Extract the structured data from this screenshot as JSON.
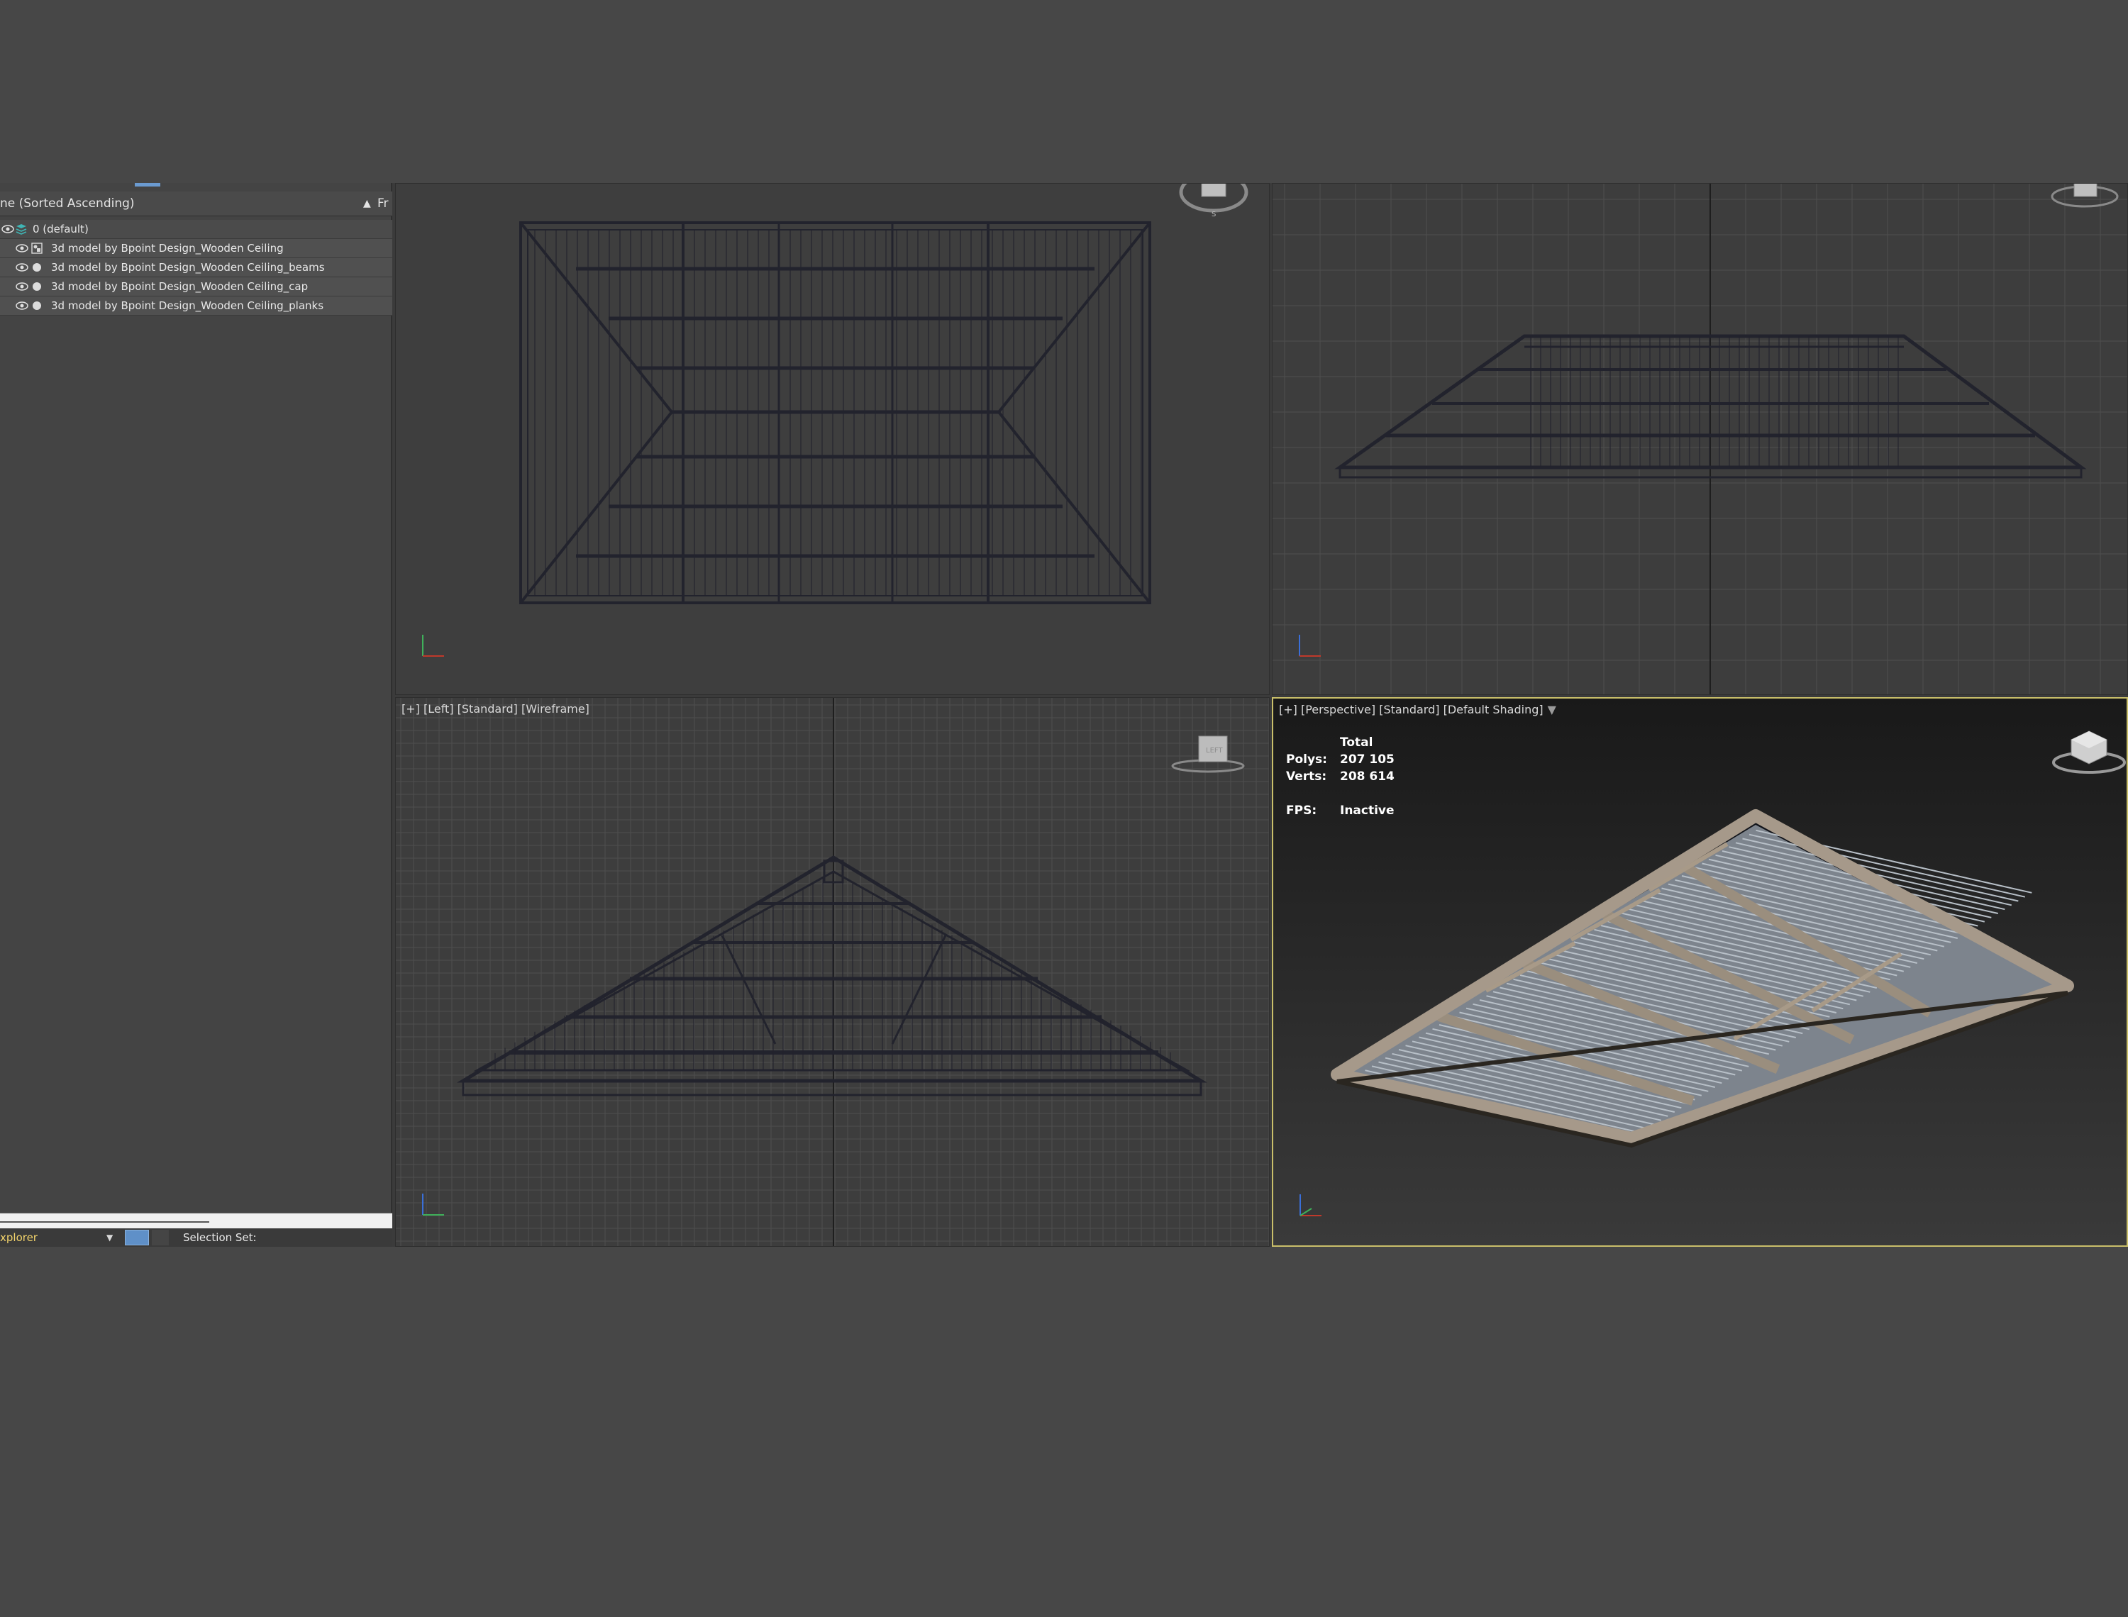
{
  "scene_explorer": {
    "column_header": "ne (Sorted Ascending)",
    "column_fr": "Fr",
    "items": [
      {
        "label": "0 (default)",
        "type": "layer"
      },
      {
        "label": "3d model by Bpoint Design_Wooden Ceiling",
        "type": "group"
      },
      {
        "label": "3d model by Bpoint Design_Wooden Ceiling_beams",
        "type": "object"
      },
      {
        "label": "3d model by Bpoint Design_Wooden Ceiling_cap",
        "type": "object"
      },
      {
        "label": "3d model by Bpoint Design_Wooden Ceiling_planks",
        "type": "object"
      }
    ],
    "footer": {
      "explorer_name": "xplorer",
      "selection_set_label": "Selection Set:"
    }
  },
  "viewports": {
    "top": {
      "label": ""
    },
    "front": {
      "label": ""
    },
    "left": {
      "label": "[+] [Left] [Standard] [Wireframe]"
    },
    "perspective": {
      "label": "[+] [Perspective] [Standard] [Default Shading]",
      "stats": {
        "total_label": "Total",
        "polys_label": "Polys:",
        "polys_value": "207 105",
        "verts_label": "Verts:",
        "verts_value": "208 614",
        "fps_label": "FPS:",
        "fps_value": "Inactive"
      }
    }
  },
  "colors": {
    "ui_background": "#474747",
    "viewport_bg": "#3d3d3d",
    "wireframe": "#22232d",
    "active_viewport_border": "#c9bf6a",
    "explorer_text": "#e8e8e8"
  }
}
